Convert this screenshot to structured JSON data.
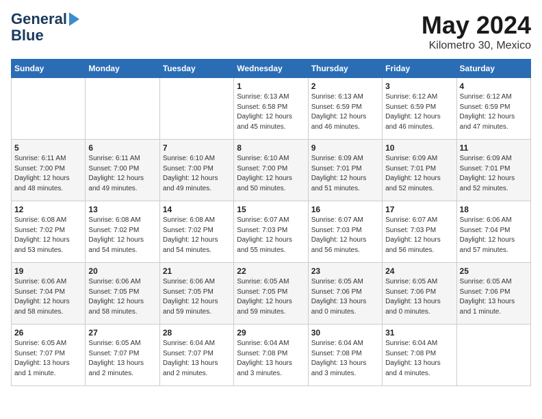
{
  "logo": {
    "line1": "General",
    "line2": "Blue"
  },
  "title": "May 2024",
  "subtitle": "Kilometro 30, Mexico",
  "days": [
    "Sunday",
    "Monday",
    "Tuesday",
    "Wednesday",
    "Thursday",
    "Friday",
    "Saturday"
  ],
  "weeks": [
    [
      {
        "num": "",
        "text": ""
      },
      {
        "num": "",
        "text": ""
      },
      {
        "num": "",
        "text": ""
      },
      {
        "num": "1",
        "text": "Sunrise: 6:13 AM\nSunset: 6:58 PM\nDaylight: 12 hours\nand 45 minutes."
      },
      {
        "num": "2",
        "text": "Sunrise: 6:13 AM\nSunset: 6:59 PM\nDaylight: 12 hours\nand 46 minutes."
      },
      {
        "num": "3",
        "text": "Sunrise: 6:12 AM\nSunset: 6:59 PM\nDaylight: 12 hours\nand 46 minutes."
      },
      {
        "num": "4",
        "text": "Sunrise: 6:12 AM\nSunset: 6:59 PM\nDaylight: 12 hours\nand 47 minutes."
      }
    ],
    [
      {
        "num": "5",
        "text": "Sunrise: 6:11 AM\nSunset: 7:00 PM\nDaylight: 12 hours\nand 48 minutes."
      },
      {
        "num": "6",
        "text": "Sunrise: 6:11 AM\nSunset: 7:00 PM\nDaylight: 12 hours\nand 49 minutes."
      },
      {
        "num": "7",
        "text": "Sunrise: 6:10 AM\nSunset: 7:00 PM\nDaylight: 12 hours\nand 49 minutes."
      },
      {
        "num": "8",
        "text": "Sunrise: 6:10 AM\nSunset: 7:00 PM\nDaylight: 12 hours\nand 50 minutes."
      },
      {
        "num": "9",
        "text": "Sunrise: 6:09 AM\nSunset: 7:01 PM\nDaylight: 12 hours\nand 51 minutes."
      },
      {
        "num": "10",
        "text": "Sunrise: 6:09 AM\nSunset: 7:01 PM\nDaylight: 12 hours\nand 52 minutes."
      },
      {
        "num": "11",
        "text": "Sunrise: 6:09 AM\nSunset: 7:01 PM\nDaylight: 12 hours\nand 52 minutes."
      }
    ],
    [
      {
        "num": "12",
        "text": "Sunrise: 6:08 AM\nSunset: 7:02 PM\nDaylight: 12 hours\nand 53 minutes."
      },
      {
        "num": "13",
        "text": "Sunrise: 6:08 AM\nSunset: 7:02 PM\nDaylight: 12 hours\nand 54 minutes."
      },
      {
        "num": "14",
        "text": "Sunrise: 6:08 AM\nSunset: 7:02 PM\nDaylight: 12 hours\nand 54 minutes."
      },
      {
        "num": "15",
        "text": "Sunrise: 6:07 AM\nSunset: 7:03 PM\nDaylight: 12 hours\nand 55 minutes."
      },
      {
        "num": "16",
        "text": "Sunrise: 6:07 AM\nSunset: 7:03 PM\nDaylight: 12 hours\nand 56 minutes."
      },
      {
        "num": "17",
        "text": "Sunrise: 6:07 AM\nSunset: 7:03 PM\nDaylight: 12 hours\nand 56 minutes."
      },
      {
        "num": "18",
        "text": "Sunrise: 6:06 AM\nSunset: 7:04 PM\nDaylight: 12 hours\nand 57 minutes."
      }
    ],
    [
      {
        "num": "19",
        "text": "Sunrise: 6:06 AM\nSunset: 7:04 PM\nDaylight: 12 hours\nand 58 minutes."
      },
      {
        "num": "20",
        "text": "Sunrise: 6:06 AM\nSunset: 7:05 PM\nDaylight: 12 hours\nand 58 minutes."
      },
      {
        "num": "21",
        "text": "Sunrise: 6:06 AM\nSunset: 7:05 PM\nDaylight: 12 hours\nand 59 minutes."
      },
      {
        "num": "22",
        "text": "Sunrise: 6:05 AM\nSunset: 7:05 PM\nDaylight: 12 hours\nand 59 minutes."
      },
      {
        "num": "23",
        "text": "Sunrise: 6:05 AM\nSunset: 7:06 PM\nDaylight: 13 hours\nand 0 minutes."
      },
      {
        "num": "24",
        "text": "Sunrise: 6:05 AM\nSunset: 7:06 PM\nDaylight: 13 hours\nand 0 minutes."
      },
      {
        "num": "25",
        "text": "Sunrise: 6:05 AM\nSunset: 7:06 PM\nDaylight: 13 hours\nand 1 minute."
      }
    ],
    [
      {
        "num": "26",
        "text": "Sunrise: 6:05 AM\nSunset: 7:07 PM\nDaylight: 13 hours\nand 1 minute."
      },
      {
        "num": "27",
        "text": "Sunrise: 6:05 AM\nSunset: 7:07 PM\nDaylight: 13 hours\nand 2 minutes."
      },
      {
        "num": "28",
        "text": "Sunrise: 6:04 AM\nSunset: 7:07 PM\nDaylight: 13 hours\nand 2 minutes."
      },
      {
        "num": "29",
        "text": "Sunrise: 6:04 AM\nSunset: 7:08 PM\nDaylight: 13 hours\nand 3 minutes."
      },
      {
        "num": "30",
        "text": "Sunrise: 6:04 AM\nSunset: 7:08 PM\nDaylight: 13 hours\nand 3 minutes."
      },
      {
        "num": "31",
        "text": "Sunrise: 6:04 AM\nSunset: 7:08 PM\nDaylight: 13 hours\nand 4 minutes."
      },
      {
        "num": "",
        "text": ""
      }
    ]
  ]
}
